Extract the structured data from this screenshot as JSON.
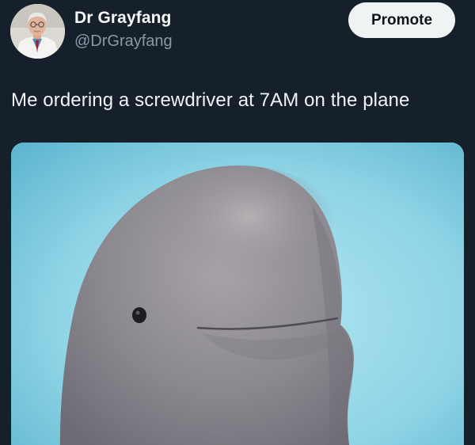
{
  "author": {
    "display_name": "Dr Grayfang",
    "handle": "@DrGrayfang",
    "avatar_icon": "doctor-portrait-avatar"
  },
  "actions": {
    "promote_label": "Promote"
  },
  "tweet": {
    "text": "Me ordering a screwdriver at 7AM on the plane",
    "media_icon": "beluga-whale-photo"
  },
  "colors": {
    "background": "#15202b",
    "primary_text": "#e7e9ea",
    "secondary_text": "#8b98a5",
    "button_bg": "#eff3f4",
    "button_text": "#0f1419"
  }
}
